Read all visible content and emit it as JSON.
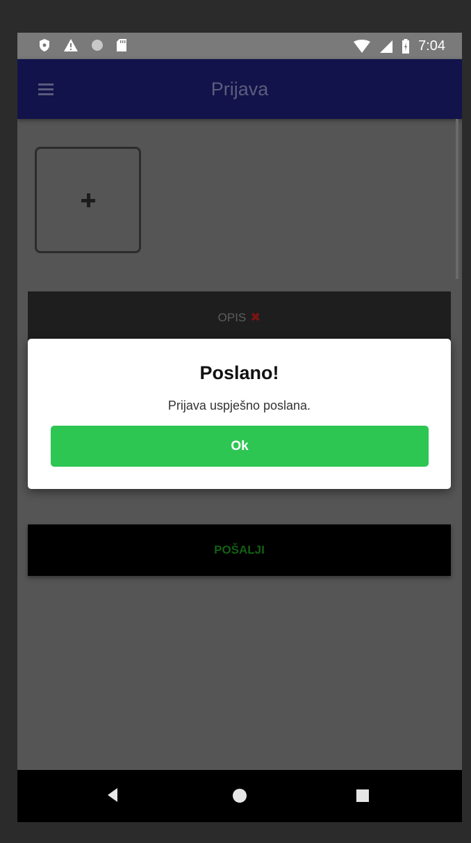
{
  "status_bar": {
    "time": "7:04",
    "left_icons": [
      "shield-icon",
      "warning-icon",
      "circle-icon",
      "sd-card-icon"
    ],
    "right_icons": [
      "wifi-icon",
      "signal-icon",
      "battery-icon"
    ]
  },
  "app_bar": {
    "title": "Prijava",
    "menu_icon": "menu-icon"
  },
  "form": {
    "add_photo_icon": "plus-icon",
    "opis_label": "OPIS",
    "opis_status": "✖",
    "send_label": "POŠALJI"
  },
  "dialog": {
    "title": "Poslano!",
    "message": "Prijava uspješno poslana.",
    "ok_label": "Ok"
  },
  "nav_bar": {
    "icons": [
      "back-icon",
      "home-icon",
      "recents-icon"
    ]
  },
  "colors": {
    "app_bar": "#13134b",
    "ok_button": "#2dc653",
    "send_text": "#135f13",
    "opis_x": "#7a1414"
  }
}
